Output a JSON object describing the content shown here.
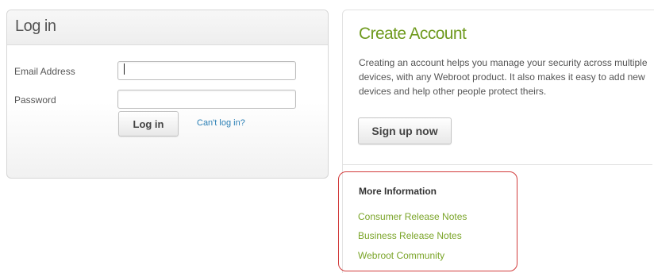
{
  "login": {
    "title": "Log in",
    "email_label": "Email Address",
    "email_value": "",
    "password_label": "Password",
    "password_value": "",
    "login_button": "Log in",
    "cant_login_link": "Can't log in?"
  },
  "create_account": {
    "title": "Create Account",
    "description": "Creating an account helps you manage your security across multiple devices, with any Webroot product. It also makes it easy to add new devices and help other people protect theirs.",
    "signup_button": "Sign up now"
  },
  "more_info": {
    "title": "More Information",
    "links": [
      "Consumer Release Notes",
      "Business Release Notes",
      "Webroot Community"
    ]
  },
  "colors": {
    "accent_green": "#6f9a1e",
    "link_blue": "#2a7fb5",
    "highlight_red": "#d23c3c"
  }
}
